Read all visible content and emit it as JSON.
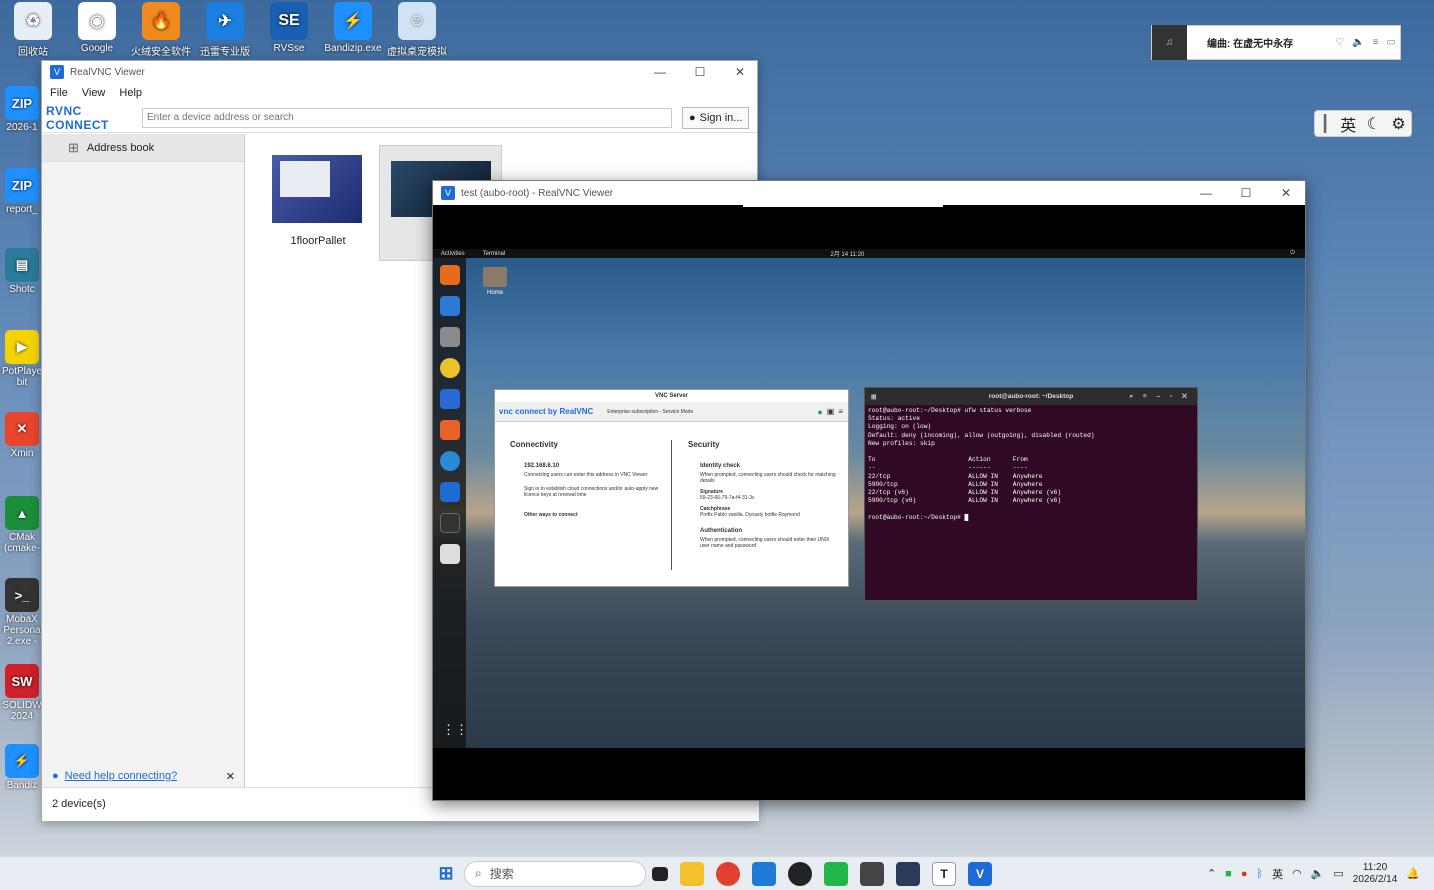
{
  "desktop": {
    "top_icons": [
      {
        "label": "回收站",
        "icon": "recycle-bin-icon",
        "color": "#e8eef5",
        "glyph": "♻"
      },
      {
        "label": "Google",
        "icon": "chrome-icon",
        "color": "#ffffff",
        "glyph": "◉"
      },
      {
        "label": "火绒安全软件",
        "icon": "huorong-icon",
        "color": "#f08a1c",
        "glyph": "🔥"
      },
      {
        "label": "迅雷专业版",
        "icon": "xunlei-icon",
        "color": "#1a7fe0",
        "glyph": "✈"
      },
      {
        "label": "RVSse",
        "icon": "rvsse-icon",
        "color": "#1a5fb4",
        "glyph": "SE"
      },
      {
        "label": "Bandizip.exe",
        "icon": "bandizip-icon",
        "color": "#1e90ff",
        "glyph": "⚡"
      },
      {
        "label": "虚拟桌宠模拟",
        "icon": "pet-icon",
        "color": "#cfe3f5",
        "glyph": "☺"
      }
    ],
    "left_icons": [
      {
        "label": "2026-1",
        "icon": "zip-shortcut-icon",
        "color": "#1e90ff",
        "glyph": "ZIP"
      },
      {
        "label": "report_",
        "icon": "zip-shortcut-icon",
        "color": "#1e90ff",
        "glyph": "ZIP"
      },
      {
        "label": "Shotc",
        "icon": "shotcut-icon",
        "color": "#2b7a99",
        "glyph": "▤"
      },
      {
        "label": "PotPlaye bit",
        "icon": "potplayer-icon",
        "color": "#f5d300",
        "glyph": "▶"
      },
      {
        "label": "Xmin",
        "icon": "xmind-icon",
        "color": "#e8452c",
        "glyph": "✕"
      },
      {
        "label": "CMak (cmake-",
        "icon": "cmake-icon",
        "color": "#1b8f3a",
        "glyph": "▲"
      },
      {
        "label": "MobaX Persona 2.exe -",
        "icon": "mobaxterm-icon",
        "color": "#333333",
        "glyph": "&gt;_"
      },
      {
        "label": "SOLIDW 2024",
        "icon": "solidworks-icon",
        "color": "#d0202a",
        "glyph": "SW"
      },
      {
        "label": "Bandiz",
        "icon": "bandizip-icon",
        "color": "#1e90ff",
        "glyph": "⚡"
      }
    ]
  },
  "music_widget": {
    "text": "编曲: 在虚无中永存"
  },
  "ime_bar": {
    "lang": "英"
  },
  "viewer": {
    "title": "RealVNC Viewer",
    "menu": [
      "File",
      "View",
      "Help"
    ],
    "brand": "RVNC CONNECT",
    "search_placeholder": "Enter a device address or search",
    "sign_in": "Sign in...",
    "address_book": "Address book",
    "devices": [
      {
        "name": "1floorPallet"
      },
      {
        "name": ""
      }
    ],
    "help_link": "Need help connecting?",
    "status": "2 device(s)"
  },
  "session": {
    "title": "test (aubo-root) - RealVNC Viewer",
    "topbar": {
      "activities": "Activities",
      "app": "Terminal",
      "clock": "2月 14 11:20"
    },
    "home_label": "Home",
    "vnc_server": {
      "title": "VNC Server",
      "brand": "vnc connect by RealVNC",
      "subscription": "Enterprise subscription - Service Mode",
      "connectivity": "Connectivity",
      "ip": "192.168.6.10",
      "ip_desc": "Connecting users can enter this address in VNC Viewer",
      "signin_desc": "Sign in to establish cloud connections and/or auto-apply new licence keys at renewal time",
      "other_ways": "Other ways to connect",
      "security": "Security",
      "identity_title": "Identity check",
      "identity_desc": "When prompted, connecting users should check for matching details",
      "signature_label": "Signature",
      "signature": "59-23-66-79-7a-f4-31-3c",
      "catchphrase_label": "Catchphrase",
      "catchphrase": "Prefix Pablo vanilla. Dynasty bottle Raymond",
      "auth_title": "Authentication",
      "auth_desc": "When prompted, connecting users should enter their UNIX user name and password"
    },
    "terminal": {
      "title": "root@aubo-root: ~/Desktop",
      "content": "root@aubo-root:~/Desktop# ufw status verbose\nStatus: active\nLogging: on (low)\nDefault: deny (incoming), allow (outgoing), disabled (routed)\nNew profiles: skip\n\nTo                         Action      From\n--                         ------      ----\n22/tcp                     ALLOW IN    Anywhere\n5900/tcp                   ALLOW IN    Anywhere\n22/tcp (v6)                ALLOW IN    Anywhere (v6)\n5900/tcp (v6)              ALLOW IN    Anywhere (v6)\n\nroot@aubo-root:~/Desktop# █"
    }
  },
  "taskbar": {
    "search": "搜索",
    "tray_lang": "英",
    "time": "11:20",
    "date": "2026/2/14"
  }
}
